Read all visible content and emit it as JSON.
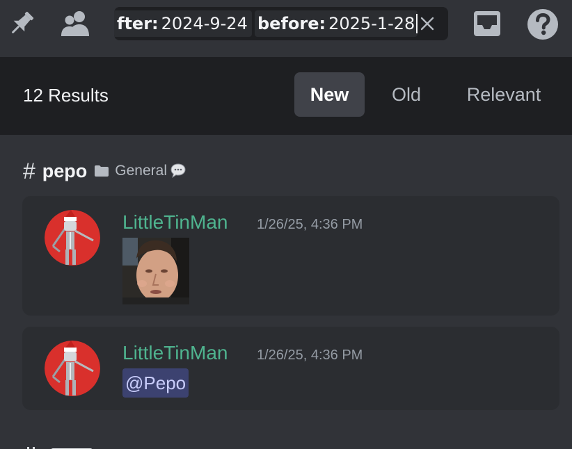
{
  "toolbar": {
    "icons": [
      "pin-icon",
      "members-icon",
      "inbox-icon",
      "help-icon"
    ]
  },
  "search": {
    "after_key": "fter:",
    "after_value": "2024-9-24",
    "before_key": "before:",
    "before_value": "2025-1-28"
  },
  "results": {
    "count_label": "12 Results",
    "tabs": [
      {
        "label": "New",
        "active": true
      },
      {
        "label": "Old",
        "active": false
      },
      {
        "label": "Relevant",
        "active": false
      }
    ]
  },
  "channel": {
    "hash": "#",
    "name": "pepo",
    "category": "General"
  },
  "messages": [
    {
      "author": "LittleTinMan",
      "timestamp": "1/26/25, 4:36 PM",
      "content_type": "image"
    },
    {
      "author": "LittleTinMan",
      "timestamp": "1/26/25, 4:36 PM",
      "mention": "@Pepo"
    }
  ],
  "colors": {
    "author": "#4fb48f",
    "mention_bg": "#3c4270",
    "avatar_bg": "#d9302c"
  }
}
